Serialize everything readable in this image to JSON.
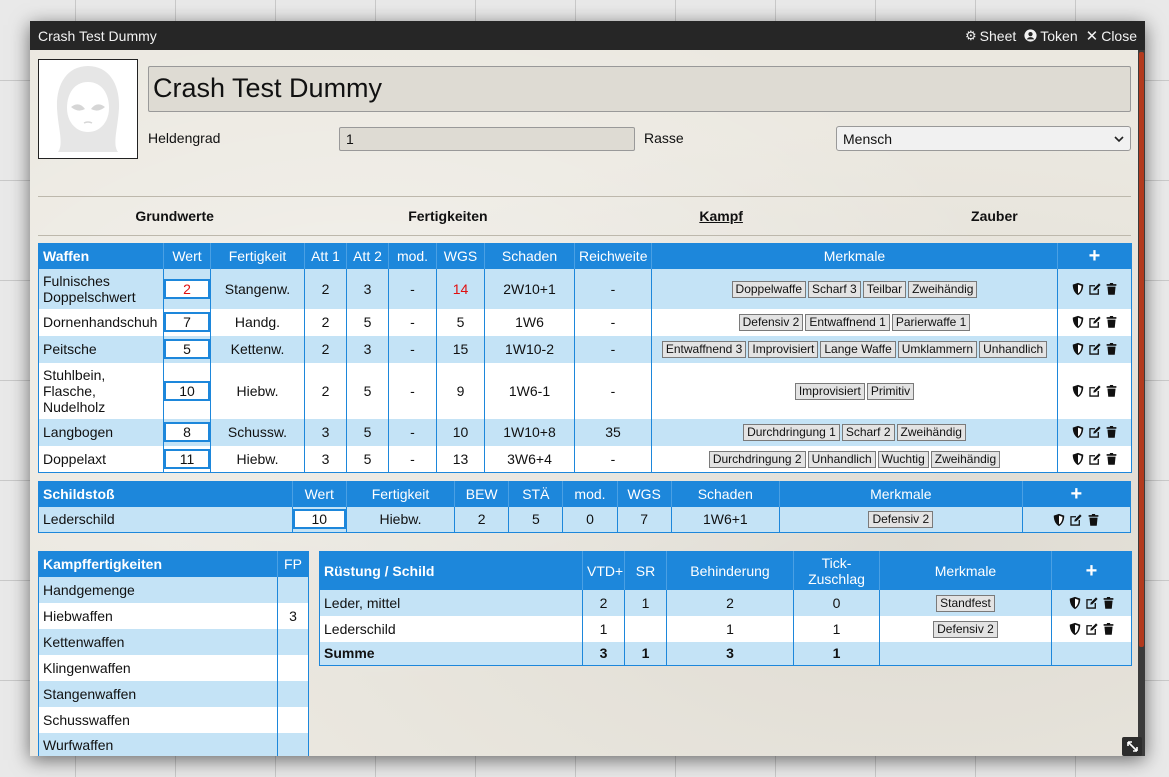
{
  "window": {
    "title": "Crash Test Dummy",
    "buttons": {
      "sheet": "Sheet",
      "token": "Token",
      "close": "Close"
    }
  },
  "header": {
    "name": "Crash Test Dummy",
    "heldengrad_label": "Heldengrad",
    "heldengrad_value": "1",
    "rasse_label": "Rasse",
    "rasse_value": "Mensch"
  },
  "tabs": [
    {
      "label": "Grundwerte",
      "active": false
    },
    {
      "label": "Fertigkeiten",
      "active": false
    },
    {
      "label": "Kampf",
      "active": true
    },
    {
      "label": "Zauber",
      "active": false
    }
  ],
  "waffen": {
    "headers": [
      "Waffen",
      "Wert",
      "Fertigkeit",
      "Att 1",
      "Att 2",
      "mod.",
      "WGS",
      "Schaden",
      "Reichweite",
      "Merkmale",
      "+"
    ],
    "rows": [
      {
        "name": "Fulnisches Doppelschwert",
        "wert": "2",
        "wert_red": true,
        "fertigkeit": "Stangenw.",
        "att1": "2",
        "att2": "3",
        "mod": "-",
        "wgs": "14",
        "wgs_red": true,
        "schaden": "2W10+1",
        "reichweite": "-",
        "merkmale": [
          "Doppelwaffe",
          "Scharf 3",
          "Teilbar",
          "Zweihändig"
        ]
      },
      {
        "name": "Dornenhandschuh",
        "wert": "7",
        "wert_red": false,
        "fertigkeit": "Handg.",
        "att1": "2",
        "att2": "5",
        "mod": "-",
        "wgs": "5",
        "wgs_red": false,
        "schaden": "1W6",
        "reichweite": "-",
        "merkmale": [
          "Defensiv 2",
          "Entwaffnend 1",
          "Parierwaffe 1"
        ]
      },
      {
        "name": "Peitsche",
        "wert": "5",
        "wert_red": false,
        "fertigkeit": "Kettenw.",
        "att1": "2",
        "att2": "3",
        "mod": "-",
        "wgs": "15",
        "wgs_red": false,
        "schaden": "1W10-2",
        "reichweite": "-",
        "merkmale": [
          "Entwaffnend 3",
          "Improvisiert",
          "Lange Waffe",
          "Umklammern",
          "Unhandlich"
        ]
      },
      {
        "name": "Stuhlbein, Flasche, Nudelholz",
        "wert": "10",
        "wert_red": false,
        "fertigkeit": "Hiebw.",
        "att1": "2",
        "att2": "5",
        "mod": "-",
        "wgs": "9",
        "wgs_red": false,
        "schaden": "1W6-1",
        "reichweite": "-",
        "merkmale": [
          "Improvisiert",
          "Primitiv"
        ]
      },
      {
        "name": "Langbogen",
        "wert": "8",
        "wert_red": false,
        "fertigkeit": "Schussw.",
        "att1": "3",
        "att2": "5",
        "mod": "-",
        "wgs": "10",
        "wgs_red": false,
        "schaden": "1W10+8",
        "reichweite": "35",
        "merkmale": [
          "Durchdringung 1",
          "Scharf 2",
          "Zweihändig"
        ]
      },
      {
        "name": "Doppelaxt",
        "wert": "11",
        "wert_red": false,
        "fertigkeit": "Hiebw.",
        "att1": "3",
        "att2": "5",
        "mod": "-",
        "wgs": "13",
        "wgs_red": false,
        "schaden": "3W6+4",
        "reichweite": "-",
        "merkmale": [
          "Durchdringung 2",
          "Unhandlich",
          "Wuchtig",
          "Zweihändig"
        ]
      }
    ]
  },
  "schildstoss": {
    "headers": [
      "Schildstoß",
      "Wert",
      "Fertigkeit",
      "BEW",
      "STÄ",
      "mod.",
      "WGS",
      "Schaden",
      "Merkmale",
      "+"
    ],
    "rows": [
      {
        "name": "Lederschild",
        "wert": "10",
        "fertigkeit": "Hiebw.",
        "bew": "2",
        "sta": "5",
        "mod": "0",
        "wgs": "7",
        "schaden": "1W6+1",
        "merkmale": [
          "Defensiv 2"
        ]
      }
    ]
  },
  "kampffertigkeiten": {
    "headers": [
      "Kampffertigkeiten",
      "FP"
    ],
    "rows": [
      {
        "name": "Handgemenge",
        "fp": ""
      },
      {
        "name": "Hiebwaffen",
        "fp": "3"
      },
      {
        "name": "Kettenwaffen",
        "fp": ""
      },
      {
        "name": "Klingenwaffen",
        "fp": ""
      },
      {
        "name": "Stangenwaffen",
        "fp": ""
      },
      {
        "name": "Schusswaffen",
        "fp": ""
      },
      {
        "name": "Wurfwaffen",
        "fp": ""
      }
    ]
  },
  "ruestung": {
    "headers": [
      "Rüstung / Schild",
      "VTD+",
      "SR",
      "Behinderung",
      "Tick-Zuschlag",
      "Merkmale",
      "+"
    ],
    "rows": [
      {
        "name": "Leder, mittel",
        "vtd": "2",
        "sr": "1",
        "beh": "2",
        "tick": "0",
        "merkmale": [
          "Standfest"
        ]
      },
      {
        "name": "Lederschild",
        "vtd": "1",
        "sr": "",
        "beh": "1",
        "tick": "1",
        "merkmale": [
          "Defensiv 2"
        ]
      }
    ],
    "summe": {
      "name": "Summe",
      "vtd": "3",
      "sr": "1",
      "beh": "3",
      "tick": "1"
    }
  },
  "colors": {
    "header_blue": "#1d87db",
    "row_light_blue": "#c4e3f6",
    "warning_red": "#e01010",
    "title_bar": "#262626"
  },
  "icons": {
    "actions": [
      "shield-icon",
      "edit-icon",
      "trash-icon"
    ],
    "title": [
      "gear-icon",
      "user-circle-icon",
      "close-icon"
    ]
  }
}
